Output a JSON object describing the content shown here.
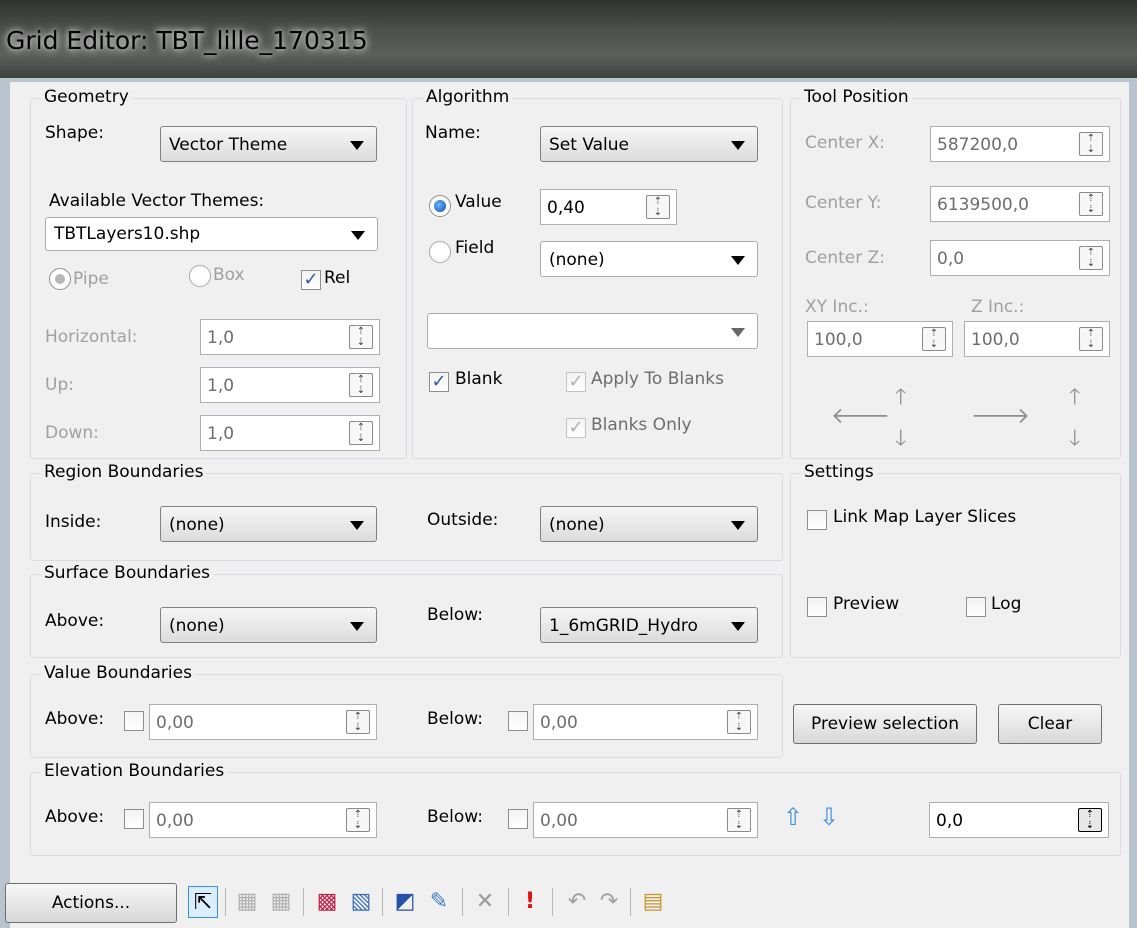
{
  "window": {
    "title": "Grid Editor: TBT_lille_170315"
  },
  "geometry": {
    "title": "Geometry",
    "shape_label": "Shape:",
    "shape_value": "Vector Theme",
    "themes_label": "Available Vector Themes:",
    "themes_value": "TBTLayers10.shp",
    "pipe_label": "Pipe",
    "box_label": "Box",
    "rel_label": "Rel",
    "horizontal_label": "Horizontal:",
    "horizontal_value": "1,0",
    "up_label": "Up:",
    "up_value": "1,0",
    "down_label": "Down:",
    "down_value": "1,0"
  },
  "algorithm": {
    "title": "Algorithm",
    "name_label": "Name:",
    "name_value": "Set Value",
    "value_label": "Value",
    "value_value": "0,40",
    "field_label": "Field",
    "field_value": "(none)",
    "extra_value": "",
    "blank_label": "Blank",
    "apply_blanks_label": "Apply To Blanks",
    "blanks_only_label": "Blanks Only"
  },
  "tool_position": {
    "title": "Tool Position",
    "cx_label": "Center X:",
    "cx_value": "587200,0",
    "cy_label": "Center Y:",
    "cy_value": "6139500,0",
    "cz_label": "Center Z:",
    "cz_value": "0,0",
    "xy_inc_label": "XY Inc.:",
    "xy_inc_value": "100,0",
    "z_inc_label": "Z Inc.:",
    "z_inc_value": "100,0"
  },
  "region": {
    "title": "Region Boundaries",
    "inside_label": "Inside:",
    "inside_value": "(none)",
    "outside_label": "Outside:",
    "outside_value": "(none)"
  },
  "settings": {
    "title": "Settings",
    "link_label": "Link Map Layer Slices",
    "preview_label": "Preview",
    "log_label": "Log"
  },
  "surface": {
    "title": "Surface Boundaries",
    "above_label": "Above:",
    "above_value": "(none)",
    "below_label": "Below:",
    "below_value": "1_6mGRID_Hydro"
  },
  "value_bounds": {
    "title": "Value Boundaries",
    "above_label": "Above:",
    "above_value": "0,00",
    "below_label": "Below:",
    "below_value": "0,00"
  },
  "buttons": {
    "preview_selection": "Preview selection",
    "clear": "Clear",
    "actions": "Actions..."
  },
  "elevation": {
    "title": "Elevation Boundaries",
    "above_label": "Above:",
    "above_value": "0,00",
    "below_label": "Below:",
    "below_value": "0,00",
    "step_value": "0,0"
  },
  "toolbar": {
    "icons": [
      "select-arrow-icon",
      "grid-select-icon",
      "grid-deselect-icon",
      "polygon-select-icon",
      "polygon-deselect-icon",
      "edit-pencil-icon",
      "eyedropper-icon",
      "delete-x-icon",
      "warning-exclamation-icon",
      "undo-icon",
      "redo-icon",
      "properties-icon"
    ]
  }
}
